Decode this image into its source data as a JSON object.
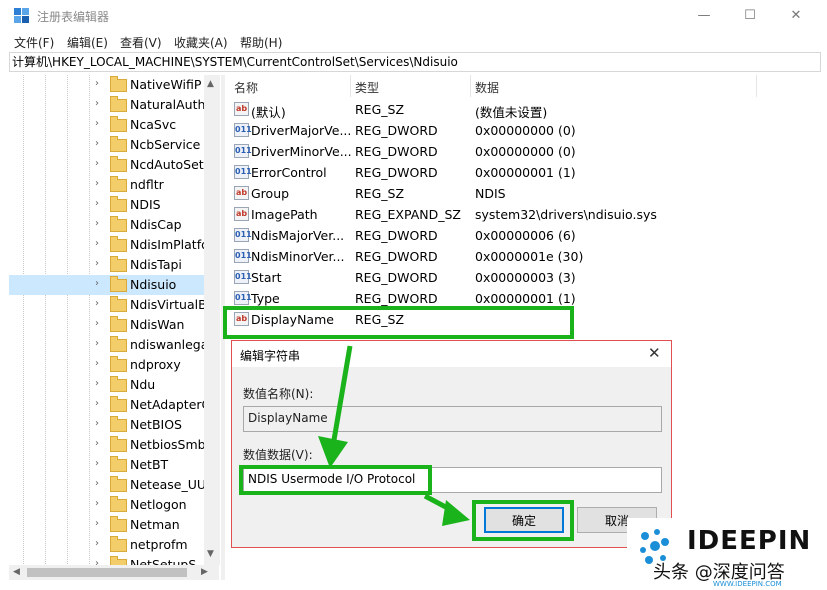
{
  "window": {
    "title": "注册表编辑器",
    "minimize": "—",
    "maximize": "☐",
    "close": "✕"
  },
  "menu": [
    "文件(F)",
    "编辑(E)",
    "查看(V)",
    "收藏夹(A)",
    "帮助(H)"
  ],
  "address": "计算机\\HKEY_LOCAL_MACHINE\\SYSTEM\\CurrentControlSet\\Services\\Ndisuio",
  "tree": {
    "items": [
      {
        "label": "NativeWifiP",
        "expandable": true
      },
      {
        "label": "NaturalAuthe",
        "expandable": true
      },
      {
        "label": "NcaSvc",
        "expandable": true
      },
      {
        "label": "NcbService",
        "expandable": true
      },
      {
        "label": "NcdAutoSetu",
        "expandable": true
      },
      {
        "label": "ndfltr",
        "expandable": true
      },
      {
        "label": "NDIS",
        "expandable": true
      },
      {
        "label": "NdisCap",
        "expandable": true
      },
      {
        "label": "NdisImPlatfo",
        "expandable": true
      },
      {
        "label": "NdisTapi",
        "expandable": true
      },
      {
        "label": "Ndisuio",
        "expandable": true,
        "selected": true
      },
      {
        "label": "NdisVirtualBu",
        "expandable": true
      },
      {
        "label": "NdisWan",
        "expandable": true
      },
      {
        "label": "ndiswanlegac",
        "expandable": true
      },
      {
        "label": "ndproxy",
        "expandable": true
      },
      {
        "label": "Ndu",
        "expandable": true
      },
      {
        "label": "NetAdapterC",
        "expandable": true
      },
      {
        "label": "NetBIOS",
        "expandable": true
      },
      {
        "label": "NetbiosSmb",
        "expandable": true
      },
      {
        "label": "NetBT",
        "expandable": true
      },
      {
        "label": "Netease_UU_",
        "expandable": true
      },
      {
        "label": "Netlogon",
        "expandable": true
      },
      {
        "label": "Netman",
        "expandable": true
      },
      {
        "label": "netprofm",
        "expandable": true
      },
      {
        "label": "NetSetupS",
        "expandable": true
      }
    ]
  },
  "list": {
    "headers": {
      "name": "名称",
      "type": "类型",
      "data": "数据"
    },
    "rows": [
      {
        "icon": "string-value-icon",
        "name": "(默认)",
        "type": "REG_SZ",
        "data": "(数值未设置)"
      },
      {
        "icon": "dword-value-icon",
        "name": "DriverMajorVe...",
        "type": "REG_DWORD",
        "data": "0x00000000 (0)"
      },
      {
        "icon": "dword-value-icon",
        "name": "DriverMinorVe...",
        "type": "REG_DWORD",
        "data": "0x00000000 (0)"
      },
      {
        "icon": "dword-value-icon",
        "name": "ErrorControl",
        "type": "REG_DWORD",
        "data": "0x00000001 (1)"
      },
      {
        "icon": "string-value-icon",
        "name": "Group",
        "type": "REG_SZ",
        "data": "NDIS"
      },
      {
        "icon": "string-value-icon",
        "name": "ImagePath",
        "type": "REG_EXPAND_SZ",
        "data": "system32\\drivers\\ndisuio.sys"
      },
      {
        "icon": "dword-value-icon",
        "name": "NdisMajorVer...",
        "type": "REG_DWORD",
        "data": "0x00000006 (6)"
      },
      {
        "icon": "dword-value-icon",
        "name": "NdisMinorVer...",
        "type": "REG_DWORD",
        "data": "0x0000001e (30)"
      },
      {
        "icon": "dword-value-icon",
        "name": "Start",
        "type": "REG_DWORD",
        "data": "0x00000003 (3)"
      },
      {
        "icon": "dword-value-icon",
        "name": "Type",
        "type": "REG_DWORD",
        "data": "0x00000001 (1)"
      },
      {
        "icon": "string-value-icon",
        "name": "DisplayName",
        "type": "REG_SZ",
        "data": ""
      }
    ]
  },
  "dialog": {
    "title": "编辑字符串",
    "close": "✕",
    "name_label": "数值名称(N):",
    "name_value": "DisplayName",
    "data_label": "数值数据(V):",
    "data_value": "NDIS Usermode I/O Protocol",
    "ok": "确定",
    "cancel": "取消"
  },
  "watermark": {
    "brand": "IDEEPIN",
    "prefix": "头条 @深度问答",
    "url": "WWW.IDEEPIN.COM"
  },
  "colors": {
    "highlight": "#1bb31b",
    "selection": "#cce8ff",
    "dialog_border": "#e05050"
  }
}
